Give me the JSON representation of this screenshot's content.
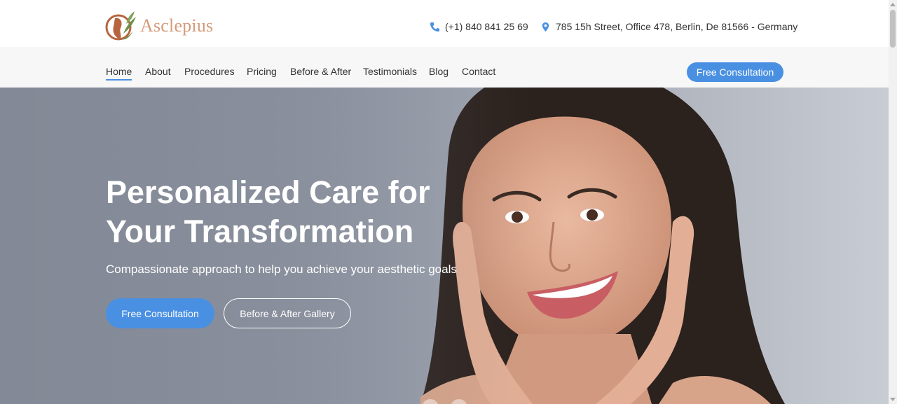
{
  "brand": {
    "name": "Asclepius",
    "logo_icon": "leaf-head-logo-icon",
    "accent": "#d59a7a"
  },
  "topbar": {
    "phone": {
      "icon": "phone-icon",
      "text": "(+1) 840 841 25 69"
    },
    "address": {
      "icon": "map-pin-icon",
      "text": "785 15h Street, Office 478, Berlin, De 81566 - Germany"
    }
  },
  "nav": {
    "items": [
      {
        "label": "Home",
        "active": true
      },
      {
        "label": "About"
      },
      {
        "label": "Procedures"
      },
      {
        "label": "Pricing"
      },
      {
        "label": "Before & After"
      },
      {
        "label": "Testimonials"
      },
      {
        "label": "Blog"
      },
      {
        "label": "Contact"
      }
    ],
    "cta_label": "Free Consultation"
  },
  "hero": {
    "title_line1": "Personalized Care for",
    "title_line2": "Your Transformation",
    "subtitle": "Compassionate approach to help you achieve your aesthetic goals",
    "primary_button": "Free Consultation",
    "secondary_button": "Before & After Gallery"
  },
  "colors": {
    "primary": "#4a90e2",
    "text": "#333333",
    "nav_bg": "#f7f7f7"
  }
}
